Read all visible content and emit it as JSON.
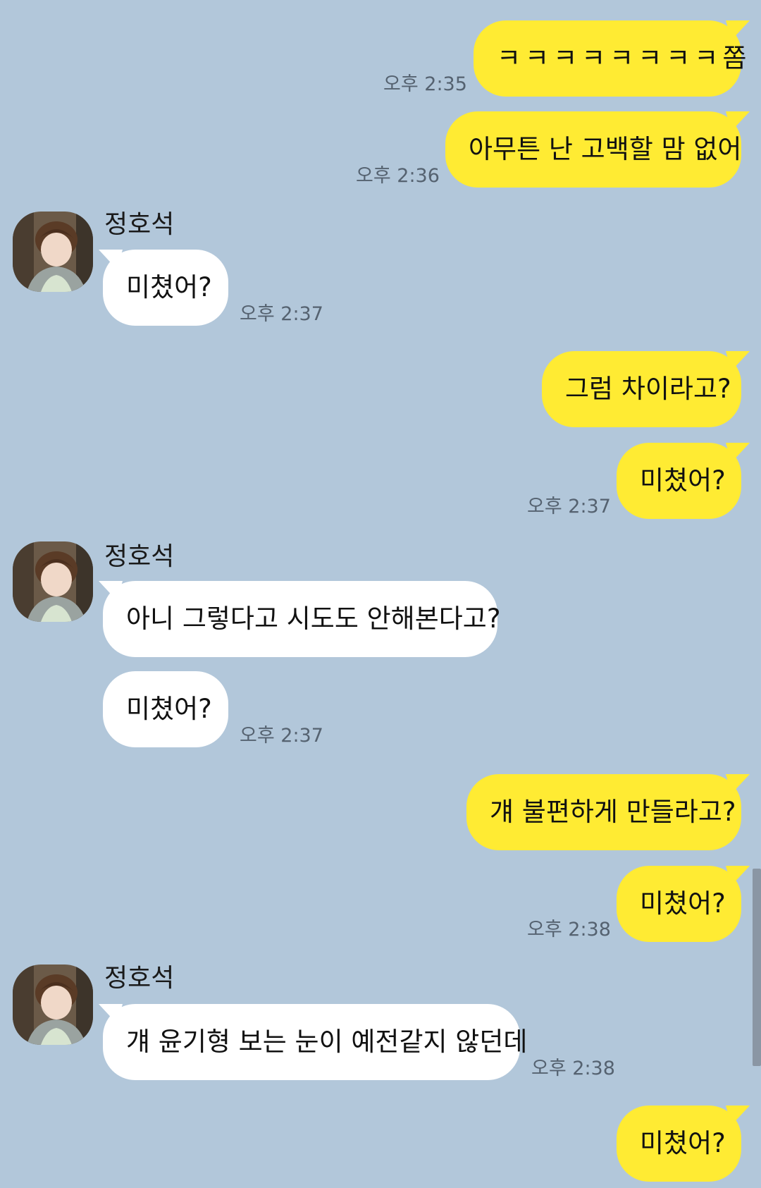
{
  "chat": {
    "contact_name": "정호석",
    "messages": [
      {
        "from": "me",
        "text": "ㅋㅋㅋㅋㅋㅋㅋㅋ쫌",
        "time": "오후 2:35"
      },
      {
        "from": "me",
        "text": "아무튼 난 고백할 맘 없어",
        "time": "오후 2:36"
      },
      {
        "from": "other",
        "sender": "정호석",
        "text": "미쳤어?",
        "time": "오후 2:37"
      },
      {
        "from": "me",
        "text": "그럼 차이라고?"
      },
      {
        "from": "me",
        "text": "미쳤어?",
        "time": "오후 2:37"
      },
      {
        "from": "other",
        "sender": "정호석",
        "text": "아니 그렇다고 시도도 안해본다고?"
      },
      {
        "from": "other",
        "text": "미쳤어?",
        "time": "오후 2:37"
      },
      {
        "from": "me",
        "text": "걔 불편하게 만들라고?"
      },
      {
        "from": "me",
        "text": "미쳤어?",
        "time": "오후 2:38"
      },
      {
        "from": "other",
        "sender": "정호석",
        "text": "걔 윤기형 보는 눈이 예전같지 않던데",
        "time": "오후 2:38"
      },
      {
        "from": "me",
        "text": "미쳤어?"
      }
    ]
  },
  "colors": {
    "background": "#b2c7da",
    "my_bubble": "#ffeb33",
    "other_bubble": "#ffffff"
  }
}
